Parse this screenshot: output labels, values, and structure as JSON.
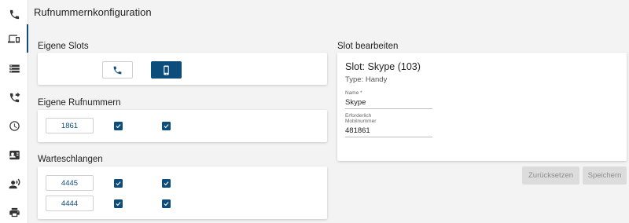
{
  "header": {
    "title": "Rufnummernkonfiguration"
  },
  "sidebar": {
    "items": [
      {
        "icon": "phone-icon",
        "active": false
      },
      {
        "icon": "devices-icon",
        "active": true
      },
      {
        "icon": "storage-icon",
        "active": false
      },
      {
        "icon": "call-forward-icon",
        "active": false
      },
      {
        "icon": "clock-icon",
        "active": false
      },
      {
        "icon": "contact-card-icon",
        "active": false
      },
      {
        "icon": "record-voice-icon",
        "active": false
      },
      {
        "icon": "printer-icon",
        "active": false
      }
    ]
  },
  "own_slots": {
    "label": "Eigene Slots",
    "buttons": [
      {
        "icon": "phone-icon",
        "selected": false
      },
      {
        "icon": "mobile-phone-icon",
        "selected": true
      }
    ]
  },
  "own_numbers": {
    "label": "Eigene Rufnummern",
    "rows": [
      {
        "number": "1861",
        "checks": [
          true,
          true
        ]
      }
    ]
  },
  "queues": {
    "label": "Warteschlangen",
    "rows": [
      {
        "number": "4445",
        "checks": [
          true,
          true
        ]
      },
      {
        "number": "4444",
        "checks": [
          true,
          true
        ]
      }
    ]
  },
  "edit_slot": {
    "label": "Slot bearbeiten",
    "title": "Slot: Skype (103)",
    "type": "Type: Handy",
    "name_label": "Name *",
    "name_value": "Skype",
    "required_label": "Erforderlich",
    "mobile_label": "Mobilnummer",
    "mobile_value": "481861"
  },
  "actions": {
    "reset_label": "Zurücksetzen",
    "save_label": "Speichern"
  },
  "colors": {
    "accent": "#0d4d7b",
    "background": "#f3f3f3",
    "disabled_button": "#dcdcdc"
  }
}
